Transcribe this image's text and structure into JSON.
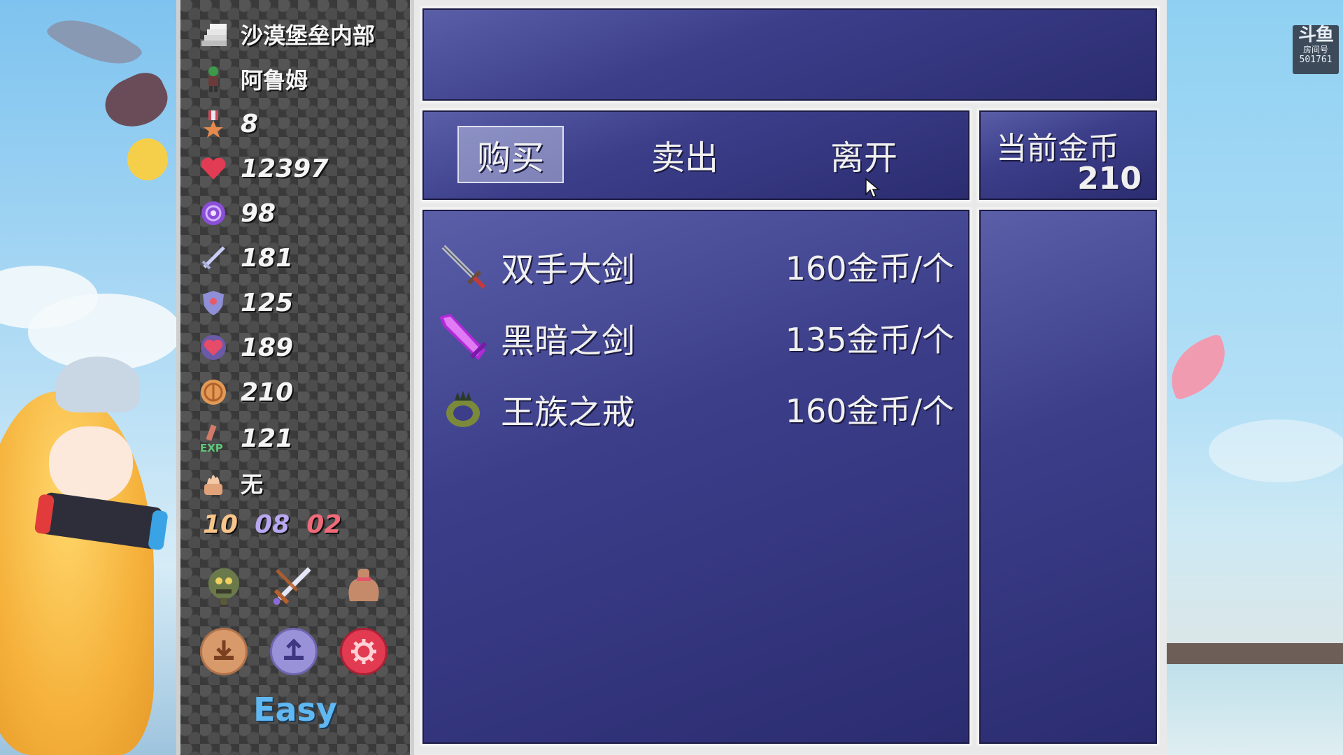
{
  "status": {
    "location": "沙漠堡垒内部",
    "hero_name": "阿鲁姆",
    "level": "8",
    "hp": "12397",
    "mana": "98",
    "attack": "181",
    "defense": "125",
    "magic_defense": "189",
    "gold": "210",
    "exp": "121",
    "equipment": "无"
  },
  "keys": {
    "yellow": "10",
    "blue": "08",
    "red": "02"
  },
  "tools": [
    "monster-manual-icon",
    "sword-icon",
    "item-bag-icon"
  ],
  "system_buttons": [
    "save-icon",
    "load-icon",
    "settings-icon"
  ],
  "difficulty": "Easy",
  "shop": {
    "menu": {
      "buy": "购买",
      "sell": "卖出",
      "leave": "离开"
    },
    "gold_label": "当前金币",
    "gold_value": "210",
    "items": [
      {
        "name": "双手大剑",
        "price": "160金币/个",
        "icon": "greatsword-icon"
      },
      {
        "name": "黑暗之剑",
        "price": "135金币/个",
        "icon": "dark-sword-icon"
      },
      {
        "name": "王族之戒",
        "price": "160金币/个",
        "icon": "royal-ring-icon"
      }
    ]
  },
  "stream_badge": {
    "logo": "斗鱼",
    "label": "房间号",
    "room": "501761"
  },
  "colors": {
    "window_bg": "#3c3e8a",
    "window_border": "#f2f2f2",
    "key_yellow": "#f7c58a",
    "key_blue": "#b9a8f0",
    "key_red": "#f06a7a",
    "difficulty": "#5fb8f2"
  }
}
